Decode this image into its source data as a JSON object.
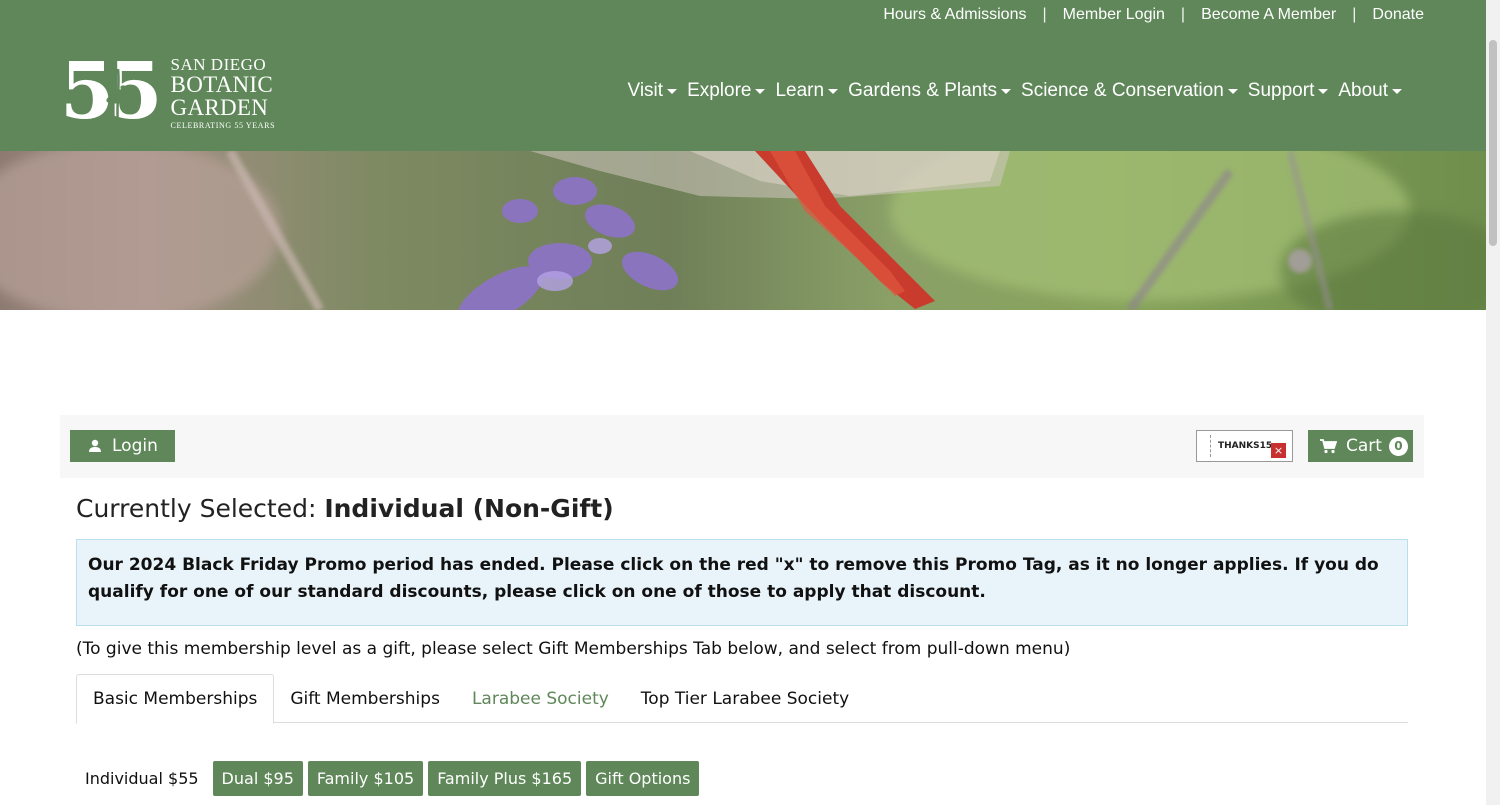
{
  "header": {
    "top_links": [
      "Hours & Admissions",
      "Member Login",
      "Become A Member",
      "Donate"
    ],
    "logo": {
      "number": "55",
      "line1": "SAN DIEGO",
      "line2": "BOTANIC",
      "line3": "GARDEN",
      "line4": "CELEBRATING 55 YEARS"
    },
    "nav": [
      "Visit",
      "Explore",
      "Learn",
      "Gardens & Plants",
      "Science & Conservation",
      "Support",
      "About"
    ]
  },
  "toolbar": {
    "login_label": "Login",
    "promo_code": "THANKS15",
    "promo_remove": "×",
    "cart_label": "Cart",
    "cart_count": "0"
  },
  "content": {
    "selected_prefix": "Currently Selected: ",
    "selected_value": "Individual (Non-Gift)",
    "alert": "Our 2024 Black Friday Promo period has ended. Please click on the red \"x\" to remove this Promo Tag, as it no longer applies. If you do qualify for one of our standard discounts, please click on one of those to apply that discount.",
    "gift_note": "(To give this membership level as a gift, please select Gift Memberships Tab below, and select from pull-down menu)",
    "tabs": [
      "Basic Memberships",
      "Gift Memberships",
      "Larabee Society",
      "Top Tier Larabee Society"
    ],
    "current_level": "Individual $55",
    "level_buttons": [
      "Dual $95",
      "Family $105",
      "Family Plus $165",
      "Gift Options"
    ]
  },
  "colors": {
    "brand_green": "#5f8759",
    "alert_bg": "#e9f4fa",
    "promo_remove_red": "#c8302f"
  }
}
